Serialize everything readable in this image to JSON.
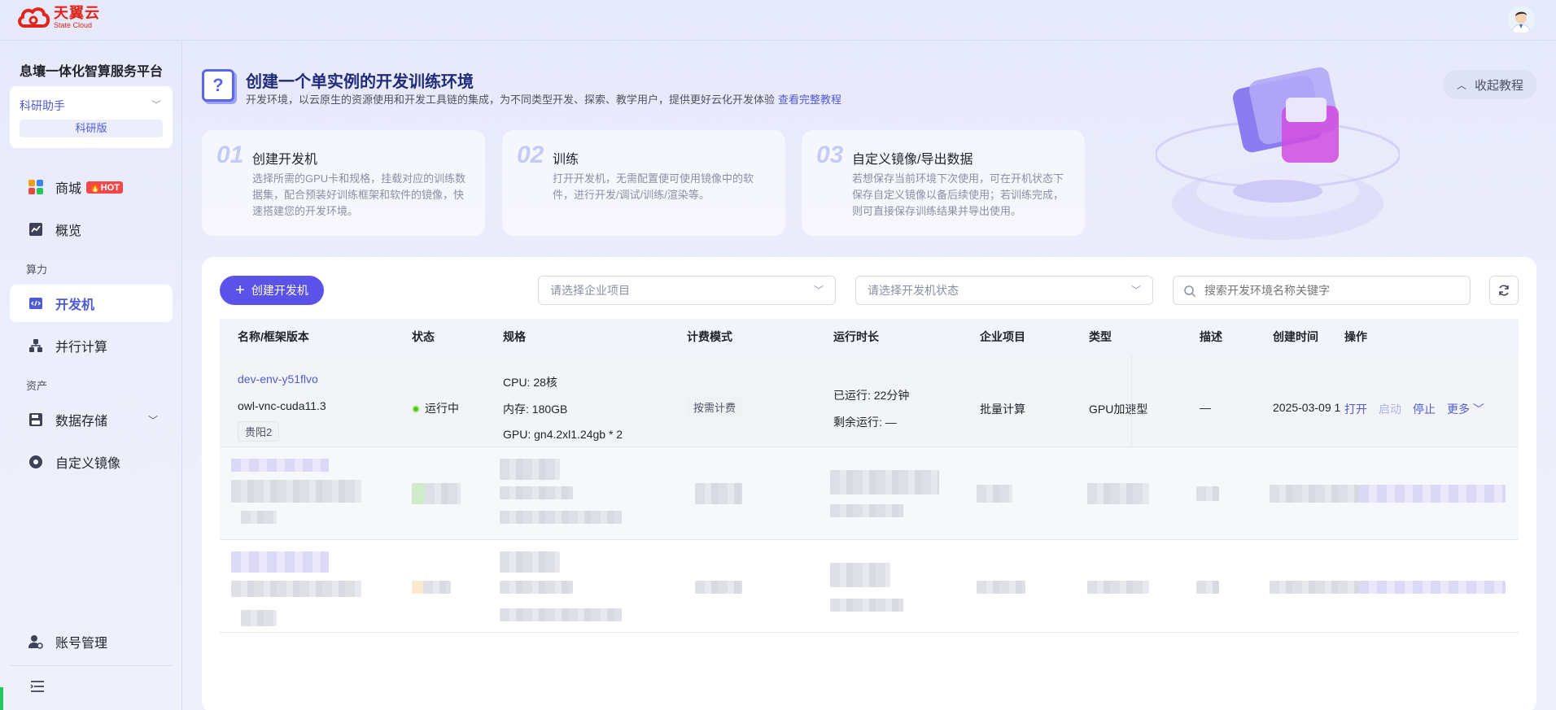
{
  "brand": {
    "name_cn": "天翼云",
    "name_en": "State Cloud"
  },
  "sidebar": {
    "platform_title": "息壤一体化智算服务平台",
    "assistant": {
      "name": "科研助手",
      "edition": "科研版"
    },
    "items": [
      {
        "label": "商城",
        "badge": "HOT"
      },
      {
        "label": "概览"
      },
      {
        "section": "算力"
      },
      {
        "label": "开发机",
        "active": true
      },
      {
        "label": "并行计算"
      },
      {
        "section": "资产"
      },
      {
        "label": "数据存储"
      },
      {
        "label": "自定义镜像"
      },
      {
        "label": "账号管理"
      }
    ]
  },
  "hero": {
    "title": "创建一个单实例的开发训练环境",
    "subtitle": "开发环境，以云原生的资源使用和开发工具链的集成，为不同类型开发、探索、教学用户，提供更好云化开发体验",
    "link": "查看完整教程",
    "collapse_label": "收起教程"
  },
  "steps": [
    {
      "num": "01",
      "title": "创建开发机",
      "desc": "选择所需的GPU卡和规格，挂载对应的训练数据集，配合预装好训练框架和软件的镜像，快速搭建您的开发环境。"
    },
    {
      "num": "02",
      "title": "训练",
      "desc": "打开开发机，无需配置便可使用镜像中的软件，进行开发/调试/训练/渲染等。"
    },
    {
      "num": "03",
      "title": "自定义镜像/导出数据",
      "desc": "若想保存当前环境下次使用，可在开机状态下保存自定义镜像以备后续使用；若训练完成，则可直接保存训练结果并导出使用。"
    }
  ],
  "toolbar": {
    "create_label": "创建开发机",
    "project_placeholder": "请选择企业项目",
    "status_placeholder": "请选择开发机状态",
    "search_placeholder": "搜索开发环境名称关键字"
  },
  "table": {
    "columns": [
      "名称/框架版本",
      "状态",
      "规格",
      "计费模式",
      "运行时长",
      "企业项目",
      "类型",
      "描述",
      "创建时间",
      "操作"
    ],
    "rows": [
      {
        "name": "dev-env-y51flvo",
        "framework": "owl-vnc-cuda11.3",
        "region": "贵阳2",
        "status": "运行中",
        "spec_cpu": "CPU: 28核",
        "spec_mem": "内存: 180GB",
        "spec_gpu": "GPU: gn4.2xl1.24gb * 2",
        "billing": "按需计费",
        "runtime_elapsed": "已运行: 22分钟",
        "runtime_remaining": "剩余运行: —",
        "project": "批量计算",
        "type": "GPU加速型",
        "description": "—",
        "created": "2025-03-09 1",
        "actions": {
          "open": "打开",
          "start": "启动",
          "stop": "停止",
          "more": "更多"
        }
      }
    ]
  },
  "colors": {
    "accent": "#5b52e9",
    "link": "#4f5bd5",
    "running": "#52c41a",
    "brand": "#e1251b",
    "hot": "#f5484a"
  }
}
